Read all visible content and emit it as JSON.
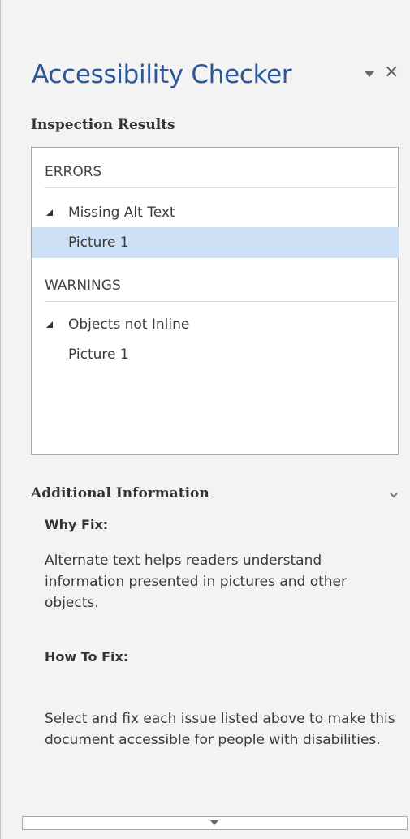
{
  "pane": {
    "title": "Accessibility Checker",
    "menu_icon": "dropdown-triangle-icon",
    "close_label": "×"
  },
  "inspection": {
    "heading": "Inspection Results",
    "groups": [
      {
        "label": "ERRORS",
        "issues": [
          {
            "label": "Missing Alt Text",
            "items": [
              {
                "label": "Picture 1",
                "selected": true
              }
            ]
          }
        ]
      },
      {
        "label": "WARNINGS",
        "issues": [
          {
            "label": "Objects not Inline",
            "items": [
              {
                "label": "Picture 1",
                "selected": false
              }
            ]
          }
        ]
      }
    ]
  },
  "additional_info": {
    "heading": "Additional Information",
    "why_fix_heading": "Why Fix:",
    "why_fix_text": "Alternate text helps readers understand information presented in pictures and other objects.",
    "how_to_fix_heading": "How To Fix:",
    "how_to_fix_text": "Select and fix each issue listed above to make this document accessible for people with disabilities."
  },
  "colors": {
    "accent": "#2b579a",
    "selection": "#cde0f5",
    "background": "#f3f3f3"
  }
}
